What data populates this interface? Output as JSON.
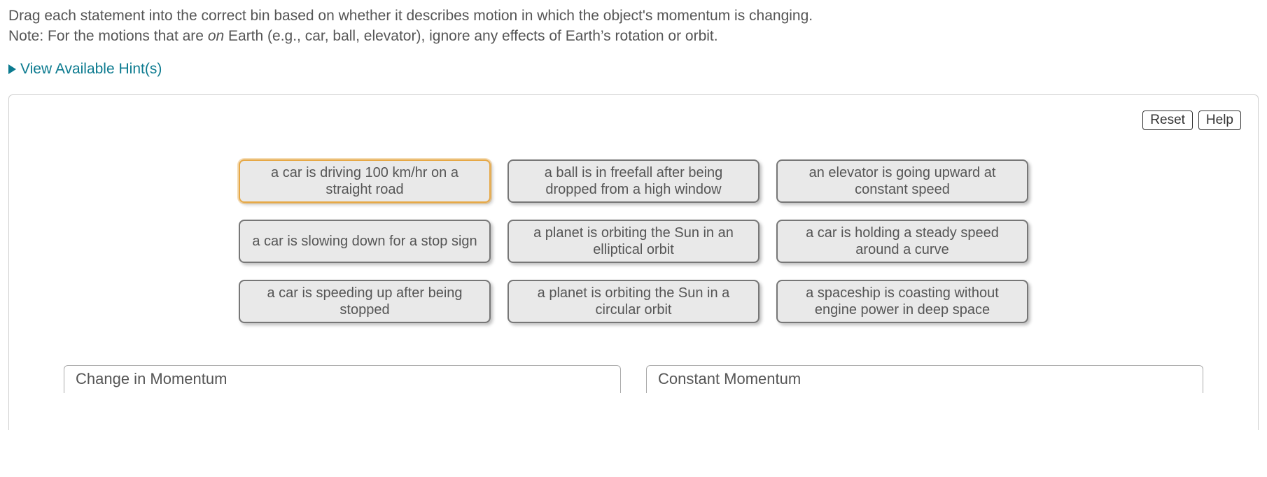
{
  "instructions": {
    "line1_a": "Drag each statement into the correct bin based on whether it describes motion in which the object's momentum is changing.",
    "line2_a": "Note: For the motions that are ",
    "line2_on": "on",
    "line2_b": " Earth (e.g., car, ball, elevator), ignore any effects of Earth’s rotation or orbit."
  },
  "hints_label": "View Available Hint(s)",
  "buttons": {
    "reset": "Reset",
    "help": "Help"
  },
  "cards": [
    [
      {
        "text": "a car is driving 100 km/hr on a straight road",
        "selected": true
      },
      {
        "text": "a ball is in freefall after being dropped from a high window",
        "selected": false
      },
      {
        "text": "an elevator is going upward at constant speed",
        "selected": false
      }
    ],
    [
      {
        "text": "a car is slowing down for a stop sign",
        "selected": false
      },
      {
        "text": "a planet is orbiting the Sun in an elliptical orbit",
        "selected": false
      },
      {
        "text": "a car is holding a steady speed around a curve",
        "selected": false
      }
    ],
    [
      {
        "text": "a car is speeding up after being stopped",
        "selected": false
      },
      {
        "text": "a planet is orbiting the Sun in a circular orbit",
        "selected": false
      },
      {
        "text": "a spaceship is coasting without engine power in deep space",
        "selected": false
      }
    ]
  ],
  "bins": {
    "left": "Change in Momentum",
    "right": "Constant Momentum"
  }
}
